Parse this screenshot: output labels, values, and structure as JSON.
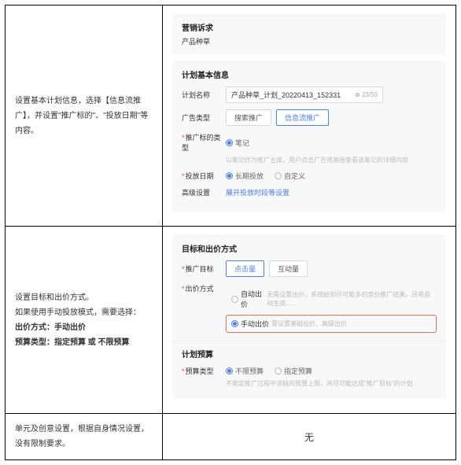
{
  "row1": {
    "left": "设置基本计划信息，选择【信息流推广】，并设置\"推广标的\"、\"投放日期\"等内容。",
    "card1": {
      "title": "营销诉求",
      "sub": "产品种草"
    },
    "card2title": "计划基本信息",
    "planName": {
      "label": "计划名称",
      "value": "产品种草_计划_20220413_152331",
      "suffix": "⊗ 23/50"
    },
    "adType": {
      "label": "广告类型",
      "opt1": "搜索推广",
      "opt2": "信息流推广"
    },
    "target": {
      "label": "推广标的类型",
      "opt1": "笔记",
      "help": "以笔记作为推广主体，用户点击广告将直接查看该笔记的详细内容"
    },
    "dates": {
      "label": "投放日期",
      "opt1": "长期投放",
      "opt2": "自定义"
    },
    "adv": {
      "label": "高级设置",
      "link": "展开投放时段等设置"
    }
  },
  "row2": {
    "left": {
      "l1": "设置目标和出价方式。",
      "l2": "如果使用手动投放模式，需要选择：",
      "l3a": "出价方式：手动出价",
      "l3b": "预算类型：指定预算 或 不限预算"
    },
    "card1title": "目标和出价方式",
    "goal": {
      "label": "推广目标",
      "opt1": "点击量",
      "opt2": "互动量"
    },
    "bid": {
      "label": "出价方式",
      "auto": "自动出价",
      "autoHint": "无需设置出价，系统给到尽可能多的竞价推广结果。还将自动生成……",
      "manual": "手动出价",
      "manualHint": "需设置基础出价、高级出价"
    },
    "card2title": "计划预算",
    "budget": {
      "label": "预算类型",
      "opt1": "不限预算",
      "opt2": "指定预算",
      "help": "不限定推广过程中消耗的预算上限，将尽可能达成\"推广目标\"的计划"
    }
  },
  "row3": {
    "left": "单元及创意设置，根据自身情况设置，没有限制要求。",
    "right": "无"
  }
}
